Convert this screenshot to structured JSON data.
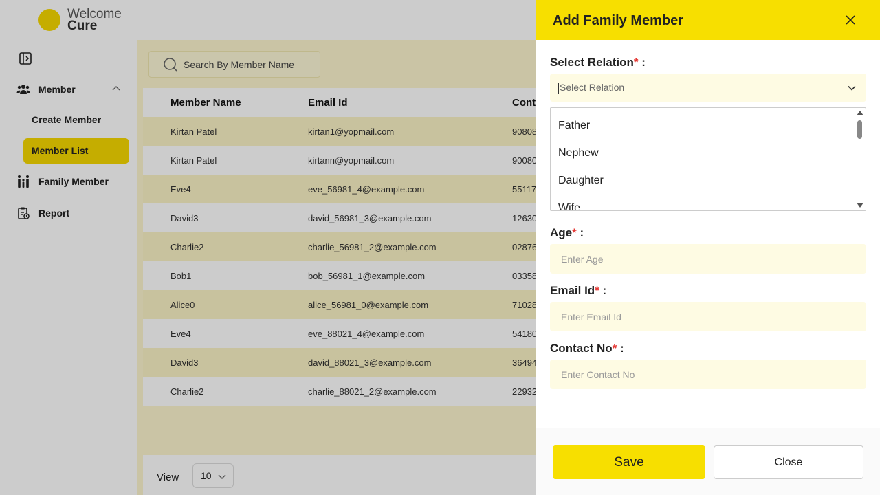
{
  "logo": {
    "line1": "Welcome",
    "line2": "Cure"
  },
  "sidebar": {
    "member_label": "Member",
    "create_member_label": "Create Member",
    "member_list_label": "Member List",
    "family_member_label": "Family Member",
    "report_label": "Report"
  },
  "search": {
    "placeholder": "Search By Member Name"
  },
  "table": {
    "headers": [
      "Member Name",
      "Email Id",
      "Cont"
    ],
    "rows": [
      [
        "Kirtan Patel",
        "kirtan1@yopmail.com",
        "90808"
      ],
      [
        "Kirtan Patel",
        "kirtann@yopmail.com",
        "90080"
      ],
      [
        "Eve4",
        "eve_56981_4@example.com",
        "55117"
      ],
      [
        "David3",
        "david_56981_3@example.com",
        "12630"
      ],
      [
        "Charlie2",
        "charlie_56981_2@example.com",
        "02876"
      ],
      [
        "Bob1",
        "bob_56981_1@example.com",
        "03358"
      ],
      [
        "Alice0",
        "alice_56981_0@example.com",
        "71028"
      ],
      [
        "Eve4",
        "eve_88021_4@example.com",
        "54180"
      ],
      [
        "David3",
        "david_88021_3@example.com",
        "36494"
      ],
      [
        "Charlie2",
        "charlie_88021_2@example.com",
        "22932"
      ]
    ]
  },
  "pagination": {
    "view_label": "View",
    "page_size": "10"
  },
  "drawer": {
    "title": "Add Family Member",
    "relation_label": "Select Relation",
    "relation_placeholder": "Select Relation",
    "relation_options": [
      "Father",
      "Nephew",
      "Daughter",
      "Wife"
    ],
    "age_label": "Age",
    "age_placeholder": "Enter Age",
    "email_label": "Email Id",
    "email_placeholder": "Enter Email Id",
    "contact_label": "Contact No",
    "contact_placeholder": "Enter Contact No",
    "required_mark": "*",
    "colon": " :",
    "save_label": "Save",
    "close_label": "Close"
  },
  "colors": {
    "accent": "#f7df00",
    "row_highlight": "#fbf3c6",
    "required": "#e53935"
  }
}
